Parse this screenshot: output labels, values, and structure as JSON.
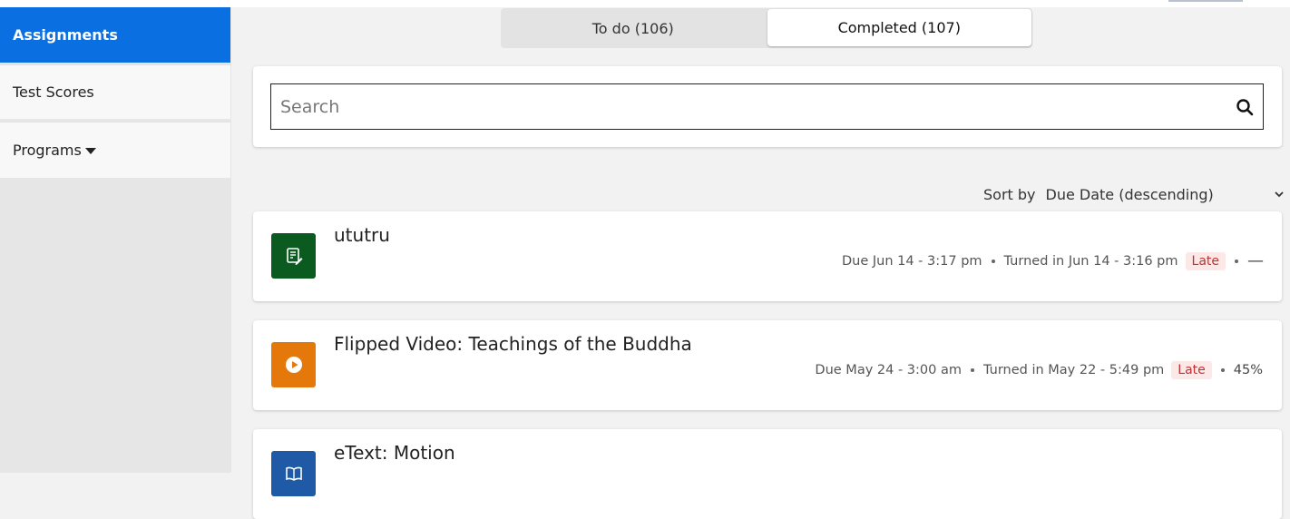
{
  "sidebar": {
    "items": [
      {
        "label": "Assignments",
        "active": true
      },
      {
        "label": "Test Scores"
      },
      {
        "label": "Programs"
      }
    ]
  },
  "tabs": [
    {
      "label": "To do (106)"
    },
    {
      "label": "Completed (107)",
      "selected": true
    }
  ],
  "search": {
    "placeholder": "Search",
    "value": ""
  },
  "sort": {
    "label": "Sort by",
    "value": "Due Date (descending)"
  },
  "assignments": [
    {
      "title": "ututru",
      "due": "Due Jun 14 - 3:17 pm",
      "turned_in": "Turned in Jun 14 - 3:16 pm",
      "status": "Late",
      "score": "—",
      "icon": "edit-document-icon",
      "icon_color": "#0b5a20"
    },
    {
      "title": "Flipped Video: Teachings of the Buddha",
      "due": "Due May 24 - 3:00 am",
      "turned_in": "Turned in May 22 - 5:49 pm",
      "status": "Late",
      "score": "45%",
      "icon": "play-icon",
      "icon_color": "#e5780a"
    },
    {
      "title": "eText: Motion",
      "icon": "book-icon",
      "icon_color": "#1f5aa6"
    }
  ],
  "colors": {
    "accent": "#0a6fe0",
    "late_text": "#c53030",
    "late_bg": "#fde8e8"
  }
}
